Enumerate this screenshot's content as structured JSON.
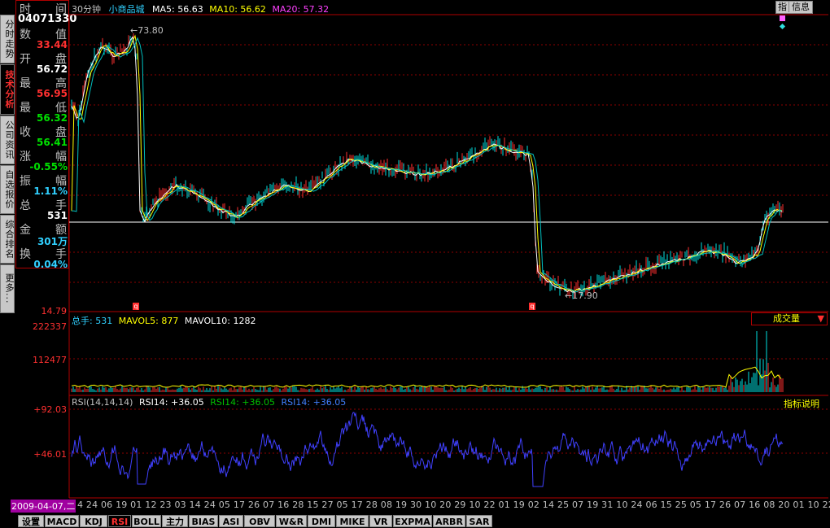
{
  "left_tabs": [
    {
      "label": "分时走势",
      "active": false
    },
    {
      "label": "技术分析",
      "active": true
    },
    {
      "label": "公司资讯",
      "active": false
    },
    {
      "label": "自选报价",
      "active": false
    },
    {
      "label": "综合排名",
      "active": false
    },
    {
      "label": "更多...",
      "active": false
    }
  ],
  "info_panel": {
    "time_label_a": "时",
    "time_label_b": "间",
    "time_value": "04071330",
    "rows": [
      {
        "la": "数",
        "lb": "值",
        "value": "33.44",
        "color": "#ff3030"
      },
      {
        "la": "开",
        "lb": "盘",
        "value": "56.72",
        "color": "#ffffff"
      },
      {
        "la": "最",
        "lb": "高",
        "value": "56.95",
        "color": "#ff3030"
      },
      {
        "la": "最",
        "lb": "低",
        "value": "56.32",
        "color": "#00e000"
      },
      {
        "la": "收",
        "lb": "盘",
        "value": "56.41",
        "color": "#00e000"
      },
      {
        "la": "涨",
        "lb": "幅",
        "value": "-0.55%",
        "color": "#00e000"
      },
      {
        "la": "振",
        "lb": "幅",
        "value": "1.11%",
        "color": "#30d0ff"
      },
      {
        "la": "总",
        "lb": "手",
        "value": "531",
        "color": "#ffffff"
      },
      {
        "la": "金",
        "lb": "额",
        "value": "301万",
        "color": "#30d0ff"
      },
      {
        "la": "换",
        "lb": "手",
        "value": "0.04%",
        "color": "#30d0ff"
      }
    ]
  },
  "header": {
    "period": "30分钟",
    "name": "小商品城",
    "ma5": "MA5: 56.63",
    "ma10": "MA10: 56.62",
    "ma20": "MA20: 57.32",
    "btn_index": "指",
    "btn_info": "信息"
  },
  "price_panel": {
    "high_mark": "73.80",
    "low_mark": "17.90",
    "y_bottom": "14.79",
    "mark_q": "q"
  },
  "volume_panel": {
    "header_total": "总手: 531",
    "header_mavol5": "MAVOL5: 877",
    "header_mavol10": "MAVOL10: 1282",
    "y_top": "222337",
    "y_mid": "112477",
    "selector": "成交量"
  },
  "rsi_panel": {
    "header_params": "RSI(14,14,14)",
    "header_rsi1": "RSI14: +36.05",
    "header_rsi2": "RSI14: +36.05",
    "header_rsi3": "RSI14: +36.05",
    "y_top": "+92.03",
    "y_mid": "+46.01",
    "explain": "指标说明"
  },
  "date_axis": {
    "first": "2009-04-07,二",
    "ticks": "4 24 06 19 01 12 23 03 14 24 05 17 26 07 16 28 15 27 05 17 28 08 19 30 10 20 29 10 22 01 19 02 14 25 07 19 31 10 24 06 15 25 05 17 26 07 16 08 20 01 10 22"
  },
  "bottom_tabs": [
    "设置",
    "MACD",
    "KDJ",
    "RSI",
    "BOLL",
    "主力",
    "BIAS",
    "ASI",
    "OBV",
    "W&R",
    "DMI",
    "MIKE",
    "VR",
    "EXPMA",
    "ARBR",
    "SAR"
  ],
  "active_bottom_tab": "RSI",
  "colors": {
    "grid": "#8b0000",
    "ma5": "#ffffff",
    "ma10": "#ffff00",
    "ma20": "#ff40ff",
    "rsi_line": "#4040ff",
    "up": "#ff3030",
    "down": "#00e0e0"
  }
}
